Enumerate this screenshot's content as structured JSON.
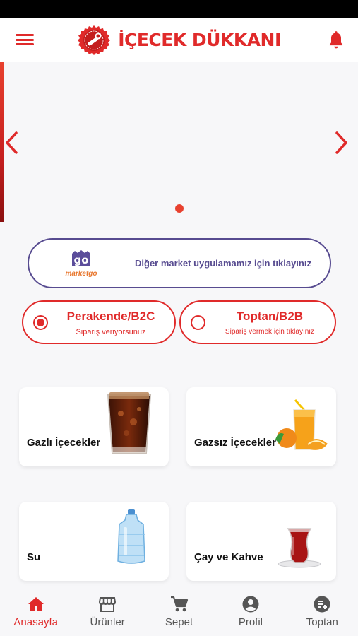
{
  "header": {
    "title": "İÇECEK DÜKKANI",
    "logo_caption": "İÇECEK DÜKKANI"
  },
  "carousel": {
    "active_index": 0,
    "slide_count": 1
  },
  "marketgo_banner": {
    "logo_text": "marketgo",
    "text": "Diğer market uygulamamız için tıklayınız"
  },
  "modes": {
    "b2c": {
      "title": "Perakende/B2C",
      "subtitle": "Sipariş veriyorsunuz",
      "selected": true
    },
    "b2b": {
      "title": "Toptan/B2B",
      "subtitle": "Sipariş vermek için tıklayınız",
      "selected": false
    }
  },
  "categories": [
    {
      "label": "Gazlı İçecekler",
      "icon": "cola-glass"
    },
    {
      "label": "Gazsız İçecekler",
      "icon": "juice-glass"
    },
    {
      "label": "Su",
      "icon": "water-jug"
    },
    {
      "label": "Çay ve Kahve",
      "icon": "tea-glass"
    }
  ],
  "bottom_nav": [
    {
      "label": "Anasayfa",
      "icon": "home-icon",
      "active": true
    },
    {
      "label": "Ürünler",
      "icon": "store-icon",
      "active": false
    },
    {
      "label": "Sepet",
      "icon": "cart-icon",
      "active": false
    },
    {
      "label": "Profil",
      "icon": "profile-icon",
      "active": false
    },
    {
      "label": "Toptan",
      "icon": "wholesale-icon",
      "active": false
    }
  ],
  "colors": {
    "accent": "#e02a2a",
    "marketgo": "#574b90",
    "background": "#f7f7f9"
  }
}
